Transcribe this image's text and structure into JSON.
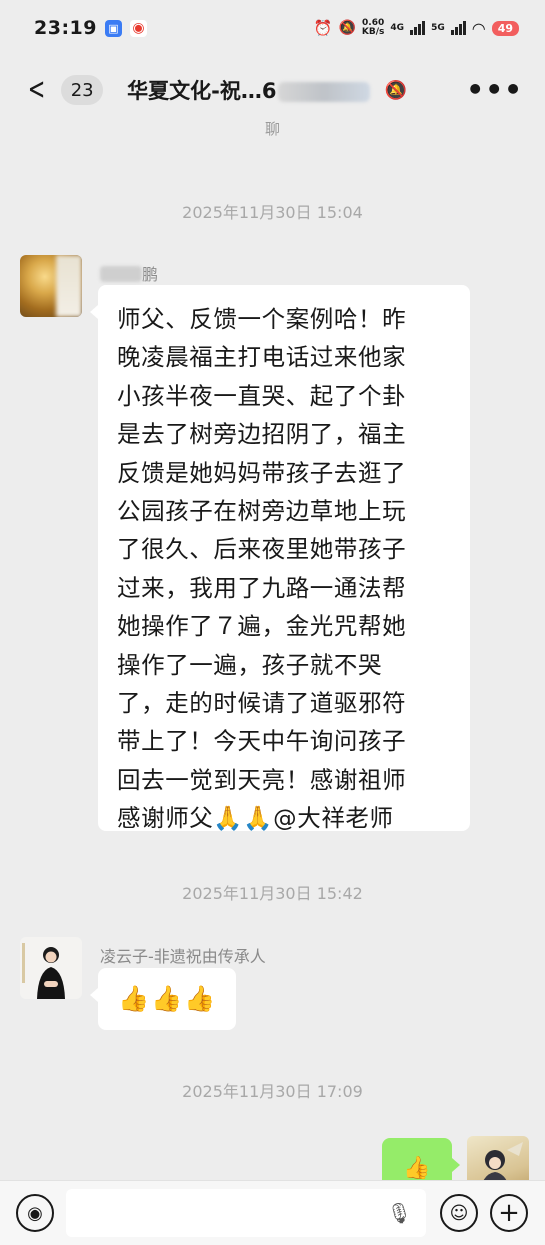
{
  "status": {
    "time": "23:19",
    "speed_value": "0.60",
    "speed_unit": "KB/s",
    "net1": "4G",
    "net2": "5G",
    "battery": "49"
  },
  "header": {
    "back_icon": "chevron-left-icon",
    "unread": "23",
    "title": "华夏文化-祝…6",
    "more": "•••"
  },
  "top_partial": "聊",
  "messages": [
    {
      "time": "2025年11月30日 15:04",
      "sender": "鹏",
      "text": "师父、反馈一个案例哈！昨\n晚凌晨福主打电话过来他家\n小孩半夜一直哭、起了个卦\n是去了树旁边招阴了，福主\n反馈是她妈妈带孩子去逛了\n公园孩子在树旁边草地上玩\n了很久、后来夜里她带孩子\n过来，我用了九路一通法帮\n她操作了７遍，金光咒帮她\n操作了一遍，孩子就不哭\n了，走的时候请了道驱邪符\n带上了！今天中午询问孩子\n回去一觉到天亮！感谢祖师\n感谢师父🙏🙏@大祥老师"
    },
    {
      "time": "2025年11月30日 15:42",
      "sender": "凌云子-非遗祝由传承人",
      "text": "👍👍👍"
    },
    {
      "time": "2025年11月30日 17:09",
      "sender": "",
      "text": "👍"
    }
  ],
  "input": {
    "placeholder": ""
  }
}
